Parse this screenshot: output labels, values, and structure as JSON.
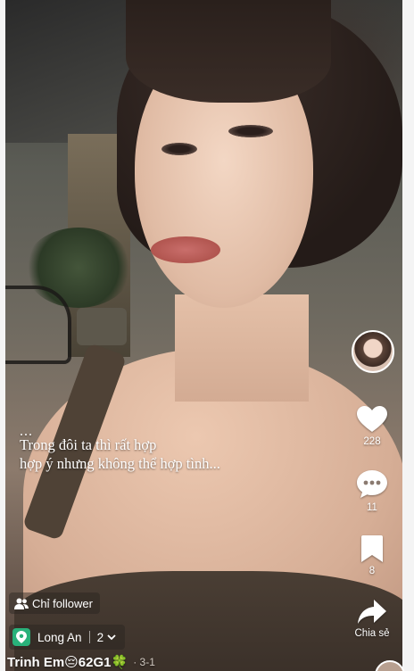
{
  "caption": {
    "ellipsis": "...",
    "line1": "Trong đôi ta thì rất hợp",
    "line2": "hợp ý nhưng không thể hợp tình..."
  },
  "actions": {
    "like": {
      "icon": "heart-icon",
      "count": "228"
    },
    "comment": {
      "icon": "comment-icon",
      "count": "11"
    },
    "save": {
      "icon": "bookmark-icon",
      "count": "8"
    },
    "share": {
      "icon": "share-icon",
      "label": "Chia sẻ"
    }
  },
  "audience": {
    "icon": "users-icon",
    "label": "Chỉ follower"
  },
  "location": {
    "icon": "map-pin-icon",
    "name": "Long An",
    "count": "2",
    "accent": "#29b17a"
  },
  "author": {
    "name": "Trinh Em😔62G1🍀",
    "meta": "· 3-1"
  }
}
